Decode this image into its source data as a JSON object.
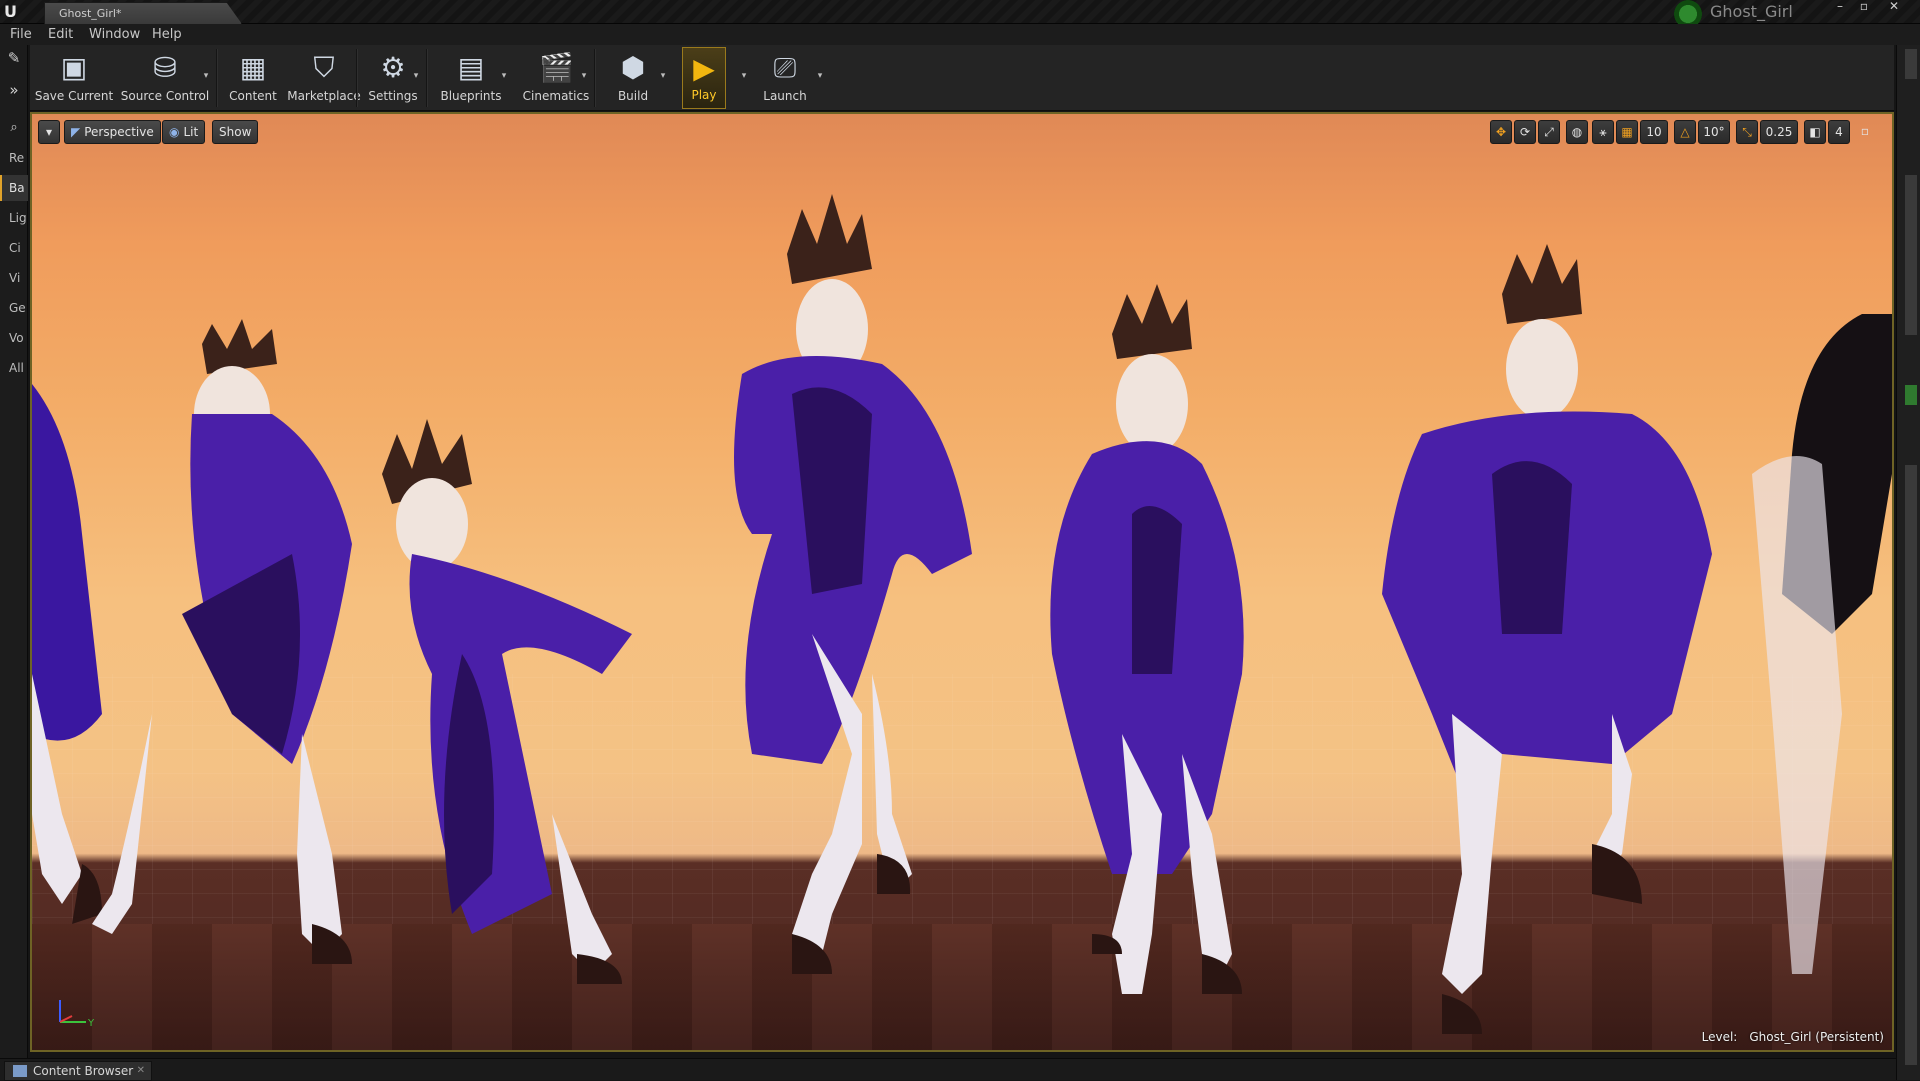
{
  "window": {
    "tab_title": "Ghost_Girl*",
    "project_name": "Ghost_Girl",
    "controls": [
      "–",
      "▫",
      "✕"
    ]
  },
  "menu": [
    "File",
    "Edit",
    "Window",
    "Help"
  ],
  "left_rail": {
    "tabs": [
      "Re",
      "Ba",
      "Lig",
      "Ci",
      "Vi",
      "Ge",
      "Vo",
      "All"
    ],
    "active_index": 1
  },
  "toolbar": {
    "buttons": [
      {
        "label": "Save Current",
        "icon": "save-icon"
      },
      {
        "label": "Source Control",
        "icon": "source-control-icon"
      },
      {
        "label": "Content",
        "icon": "content-icon"
      },
      {
        "label": "Marketplace",
        "icon": "marketplace-icon"
      },
      {
        "label": "Settings",
        "icon": "settings-icon"
      },
      {
        "label": "Blueprints",
        "icon": "blueprints-icon"
      },
      {
        "label": "Cinematics",
        "icon": "cinematics-icon"
      },
      {
        "label": "Build",
        "icon": "build-icon"
      },
      {
        "label": "Play",
        "icon": "play-icon"
      },
      {
        "label": "Launch",
        "icon": "launch-icon"
      }
    ]
  },
  "viewport": {
    "view_mode": "Perspective",
    "lighting": "Lit",
    "show_label": "Show",
    "grid_snap": "10",
    "rotation_snap": "10°",
    "scale_snap": "0.25",
    "camera_speed": "4",
    "level_label": "Level:",
    "level_name": "Ghost_Girl (Persistent)",
    "axis_y": "Y"
  },
  "bottom": {
    "content_browser_tab": "Content Browser"
  },
  "colors": {
    "accent": "#e0a22a",
    "robe": "#4a1fa8",
    "robe_dark": "#2a0f5e",
    "skin": "#e9e6ea",
    "hair": "#f1e2da"
  }
}
